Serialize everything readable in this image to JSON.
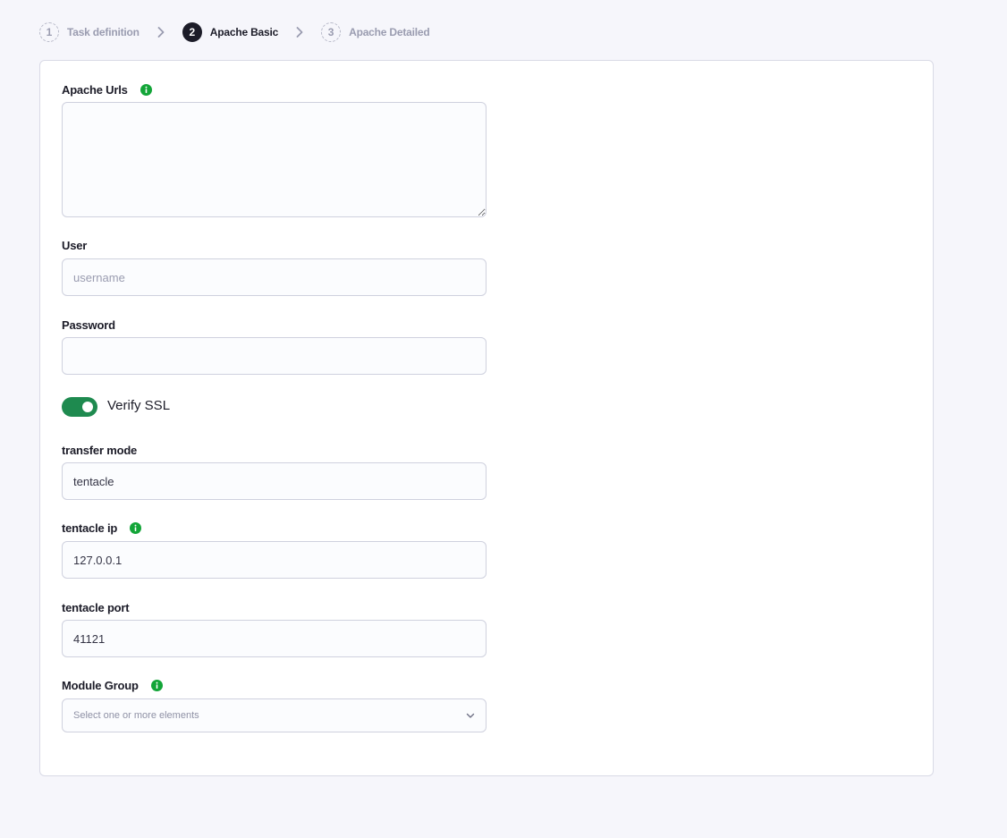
{
  "stepper": {
    "steps": [
      {
        "number": "1",
        "label": "Task definition",
        "state": "inactive"
      },
      {
        "number": "2",
        "label": "Apache Basic",
        "state": "active"
      },
      {
        "number": "3",
        "label": "Apache Detailed",
        "state": "inactive"
      }
    ],
    "separator_icon": "chevron-right-icon"
  },
  "form": {
    "apache_urls": {
      "label": "Apache Urls",
      "value": "",
      "info_icon": "info-icon"
    },
    "user": {
      "label": "User",
      "placeholder": "username",
      "value": ""
    },
    "password": {
      "label": "Password",
      "value": ""
    },
    "verify_ssl": {
      "label": "Verify SSL",
      "enabled": true
    },
    "transfer_mode": {
      "label": "transfer mode",
      "value": "tentacle"
    },
    "tentacle_ip": {
      "label": "tentacle ip",
      "value": "127.0.0.1",
      "info_icon": "info-icon"
    },
    "tentacle_port": {
      "label": "tentacle port",
      "value": "41121"
    },
    "module_group": {
      "label": "Module Group",
      "placeholder": "Select one or more elements",
      "info_icon": "info-icon",
      "dropdown_icon": "chevron-down-icon"
    }
  },
  "colors": {
    "accent_green": "#1e8a4f",
    "info_green": "#13a538",
    "active_step": "#1c1c28",
    "inactive_text": "#9a9cb0"
  }
}
